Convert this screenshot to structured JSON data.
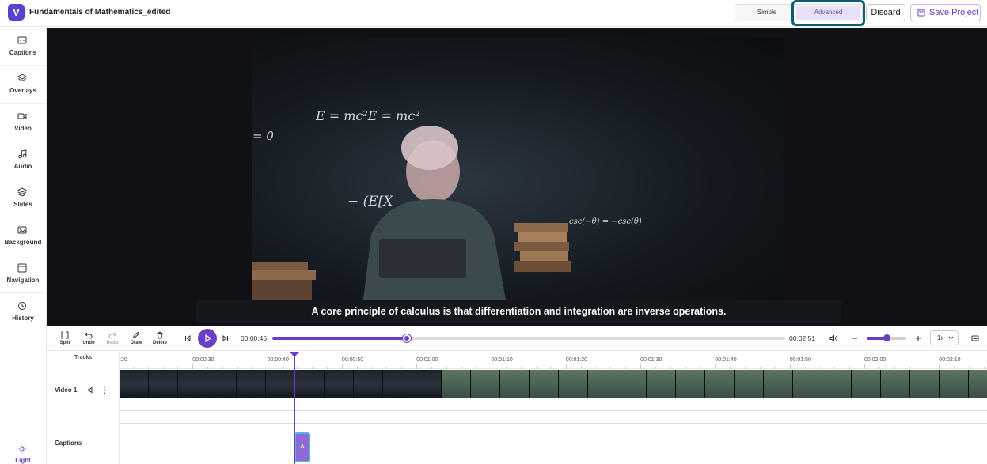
{
  "app": {
    "logo_letter": "V",
    "title": "Fundamentals of Mathematics_edited",
    "accent": "#6a3fc5"
  },
  "header": {
    "mode_simple": "Simple",
    "mode_advanced": "Advanced",
    "discard": "Discard",
    "save": "Save Project"
  },
  "sidebar": {
    "items": [
      {
        "label": "Captions",
        "icon": "captions-icon"
      },
      {
        "label": "Overlays",
        "icon": "layers-icon"
      },
      {
        "label": "Video",
        "icon": "video-icon"
      },
      {
        "label": "Audio",
        "icon": "music-note-icon"
      },
      {
        "label": "Slides",
        "icon": "stack-icon"
      },
      {
        "label": "Background",
        "icon": "image-icon"
      },
      {
        "label": "Navigation",
        "icon": "layout-icon"
      },
      {
        "label": "History",
        "icon": "history-icon"
      }
    ],
    "theme_label": "Light"
  },
  "player": {
    "subtitle": "A core principle of calculus is that differentiation and integration are inverse operations.",
    "overlay_text": [
      "E = mc²E = mc²",
      "= 0",
      "csc(−θ) = −csc(θ)",
      "− (E[X"
    ]
  },
  "controls": {
    "tools": [
      {
        "label": "Split",
        "enabled": true
      },
      {
        "label": "Undo",
        "enabled": true
      },
      {
        "label": "Redo",
        "enabled": false
      },
      {
        "label": "Draw",
        "enabled": true
      },
      {
        "label": "Delete",
        "enabled": true
      }
    ],
    "current_time": "00:00:45",
    "total_time": "00:02:51",
    "progress_fraction": 0.263,
    "zoom_fraction": 0.5,
    "speed": "1x"
  },
  "timeline": {
    "tracks_header": "Tracks",
    "track_video": "Video 1",
    "track_captions": "Captions",
    "caption_clip_label": "A",
    "ticks": [
      ":20",
      "00:00:30",
      "00:00:40",
      "00:00:50",
      "00:01:00",
      "00:01:10",
      "00:01:20",
      "00:01:30",
      "00:01:40",
      "00:01:50",
      "00:02:00",
      "00:02:10"
    ]
  }
}
